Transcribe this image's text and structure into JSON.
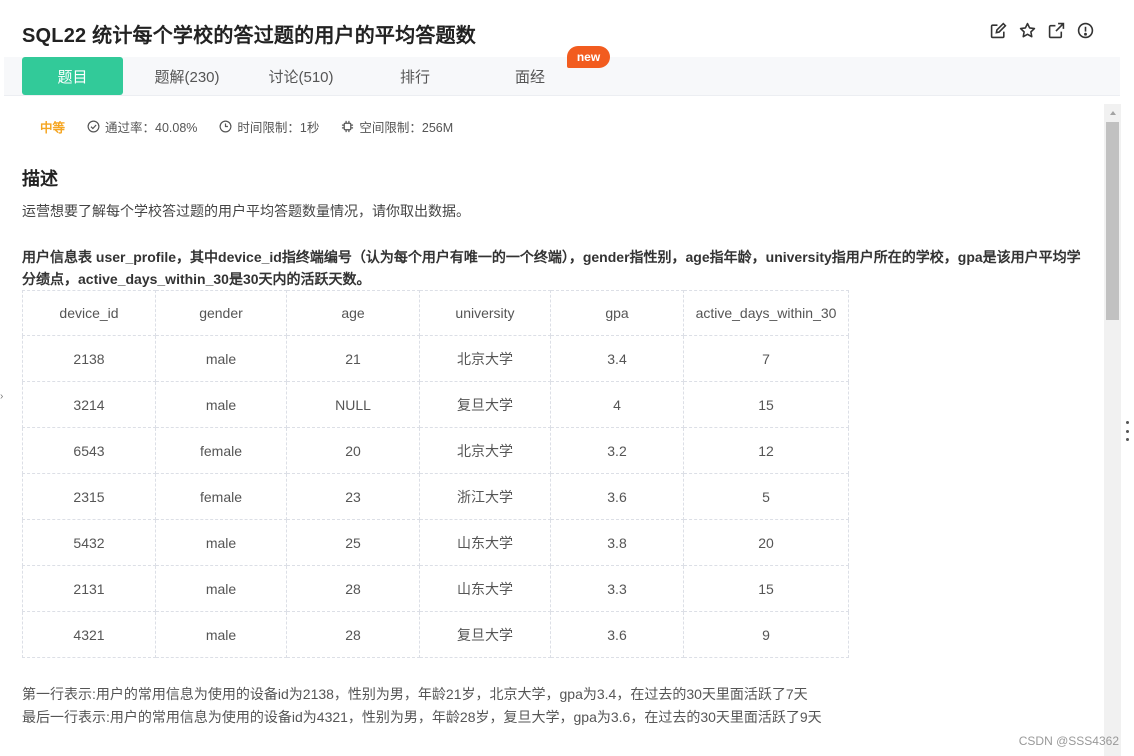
{
  "header": {
    "title": "SQL22  统计每个学校的答过题的用户的平均答题数",
    "icons": [
      "edit-icon",
      "star-icon",
      "external-link-icon",
      "info-icon"
    ]
  },
  "tabs": [
    {
      "label": "题目",
      "active": true
    },
    {
      "label": "题解(230)",
      "active": false
    },
    {
      "label": "讨论(510)",
      "active": false
    },
    {
      "label": "排行",
      "active": false
    },
    {
      "label": "面经",
      "active": false
    }
  ],
  "badge": "new",
  "meta": {
    "level": "中等",
    "pass_rate": "通过率：40.08%",
    "time_limit": "时间限制：1秒",
    "space_limit": "空间限制：256M"
  },
  "description": {
    "title": "描述",
    "intro": "运营想要了解每个学校答过题的用户平均答题数量情况，请你取出数据。",
    "table_desc": "用户信息表 user_profile，其中device_id指终端编号（认为每个用户有唯一的一个终端），gender指性别，age指年龄，university指用户所在的学校，gpa是该用户平均学分绩点，active_days_within_30是30天内的活跃天数。"
  },
  "table": {
    "headers": [
      "device_id",
      "gender",
      "age",
      "university",
      "gpa",
      "active_days_within_30"
    ],
    "rows": [
      [
        "2138",
        "male",
        "21",
        "北京大学",
        "3.4",
        "7"
      ],
      [
        "3214",
        "male",
        "NULL",
        "复旦大学",
        "4",
        "15"
      ],
      [
        "6543",
        "female",
        "20",
        "北京大学",
        "3.2",
        "12"
      ],
      [
        "2315",
        "female",
        "23",
        "浙江大学",
        "3.6",
        "5"
      ],
      [
        "5432",
        "male",
        "25",
        "山东大学",
        "3.8",
        "20"
      ],
      [
        "2131",
        "male",
        "28",
        "山东大学",
        "3.3",
        "15"
      ],
      [
        "4321",
        "male",
        "28",
        "复旦大学",
        "3.6",
        "9"
      ]
    ]
  },
  "notes": {
    "first": "第一行表示:用户的常用信息为使用的设备id为2138，性别为男，年龄21岁，北京大学，gpa为3.4，在过去的30天里面活跃了7天",
    "last": "最后一行表示:用户的常用信息为使用的设备id为4321，性别为男，年龄28岁，复旦大学，gpa为3.6，在过去的30天里面活跃了9天"
  },
  "watermark": "CSDN @SSS4362",
  "colors": {
    "accent": "#32ca99",
    "badge": "#f25c1f",
    "level": "#f5a623"
  }
}
